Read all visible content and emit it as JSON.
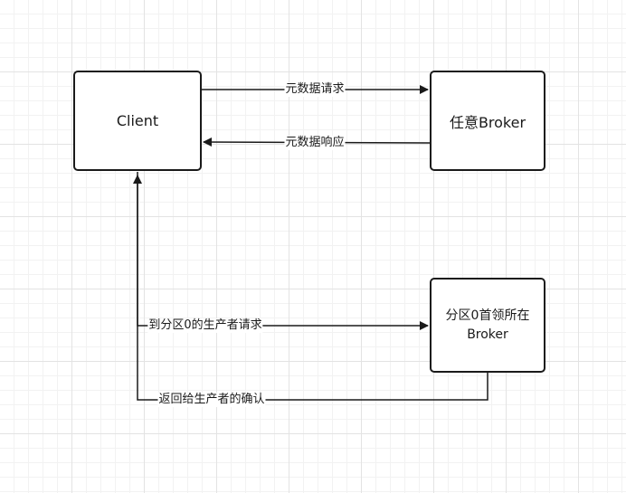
{
  "nodes": {
    "client": "Client",
    "any_broker": "任意Broker",
    "leader_broker": "分区0首领所在\nBroker"
  },
  "edges": {
    "metadata_request": "元数据请求",
    "metadata_response": "元数据响应",
    "produce_request": "到分区0的生产者请求",
    "ack": "返回给生产者的确认"
  },
  "colors": {
    "stroke": "#1a1a1a",
    "grid": "#e3e3e3",
    "background": "#ffffff"
  }
}
